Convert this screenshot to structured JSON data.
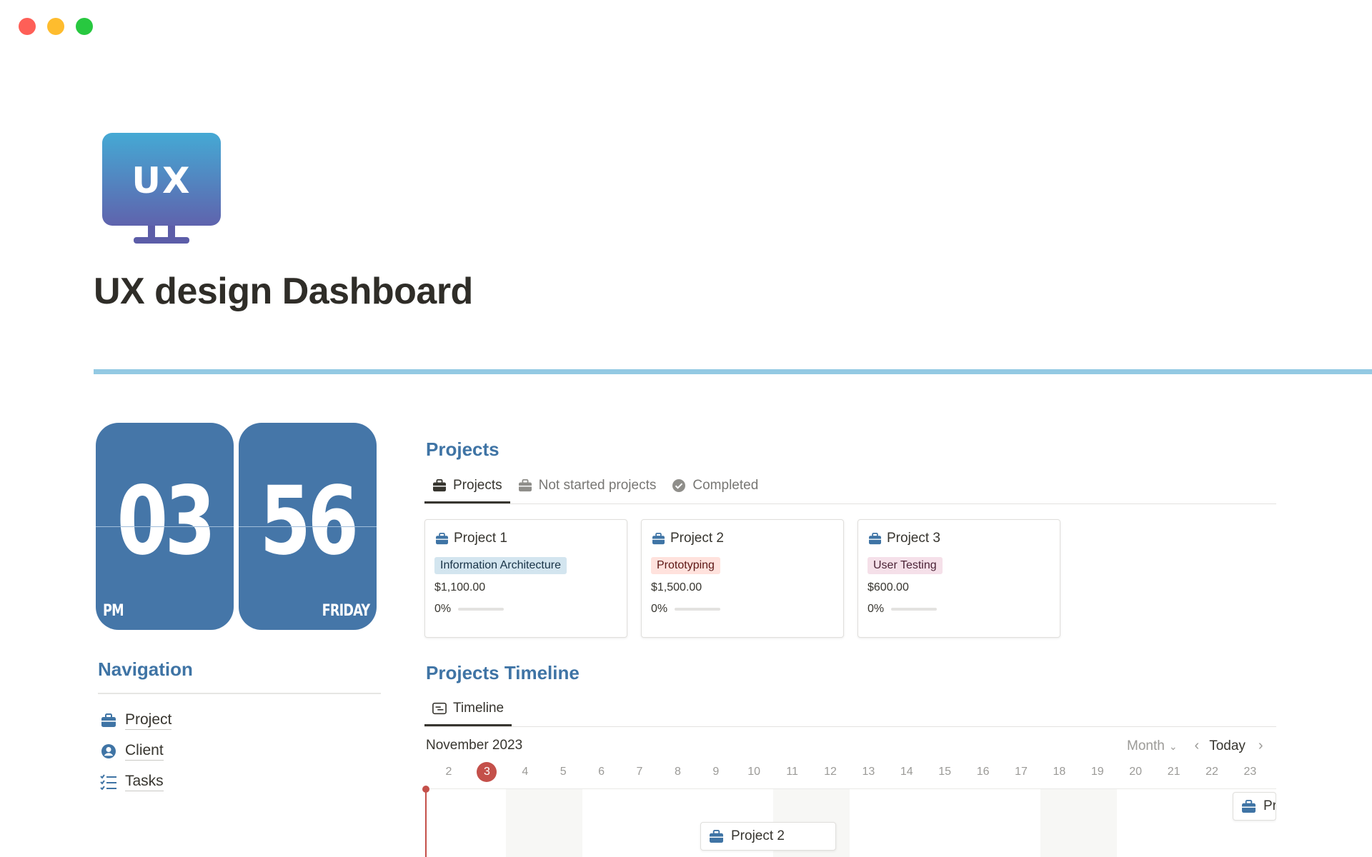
{
  "window": {
    "controls": [
      "close",
      "minimize",
      "zoom"
    ]
  },
  "page": {
    "icon": {
      "name": "ux-monitor-icon",
      "text": "UX"
    },
    "title": "UX design Dashboard"
  },
  "colors": {
    "accent_blue": "#3f74a5",
    "clock_blue": "#4576a8",
    "divider": "#93c9e3",
    "today_red": "#c4504a"
  },
  "clock": {
    "hour": "03",
    "minute": "56",
    "meridiem": "PM",
    "weekday": "FRIDAY"
  },
  "navigation": {
    "heading": "Navigation",
    "items": [
      {
        "label": "Project",
        "icon": "briefcase-icon"
      },
      {
        "label": "Client",
        "icon": "user-circle-icon"
      },
      {
        "label": "Tasks",
        "icon": "checklist-icon"
      }
    ]
  },
  "projects": {
    "heading": "Projects",
    "tabs": [
      {
        "label": "Projects",
        "icon": "briefcase-icon",
        "active": true
      },
      {
        "label": "Not started projects",
        "icon": "briefcase-icon",
        "active": false
      },
      {
        "label": "Completed",
        "icon": "check-circle-icon",
        "active": false
      }
    ],
    "cards": [
      {
        "title": "Project 1",
        "tag": "Information Architecture",
        "tag_color": "blue",
        "price": "$1,100.00",
        "progress_label": "0%",
        "progress": 0
      },
      {
        "title": "Project 2",
        "tag": "Prototyping",
        "tag_color": "red",
        "price": "$1,500.00",
        "progress_label": "0%",
        "progress": 0
      },
      {
        "title": "Project 3",
        "tag": "User Testing",
        "tag_color": "pink",
        "price": "$600.00",
        "progress_label": "0%",
        "progress": 0
      }
    ]
  },
  "timeline": {
    "heading": "Projects Timeline",
    "tabs": [
      {
        "label": "Timeline",
        "icon": "timeline-icon",
        "active": true
      }
    ],
    "month": "November 2023",
    "view": "Month",
    "today_label": "Today",
    "days": [
      "2",
      "3",
      "4",
      "5",
      "6",
      "7",
      "8",
      "9",
      "10",
      "11",
      "12",
      "13",
      "14",
      "15",
      "16",
      "17",
      "18",
      "19",
      "20",
      "21",
      "22",
      "23"
    ],
    "today_day": "3",
    "items": [
      {
        "label": "Project 2",
        "icon": "briefcase-icon"
      },
      {
        "label": "Pr",
        "icon": "briefcase-icon"
      }
    ]
  }
}
